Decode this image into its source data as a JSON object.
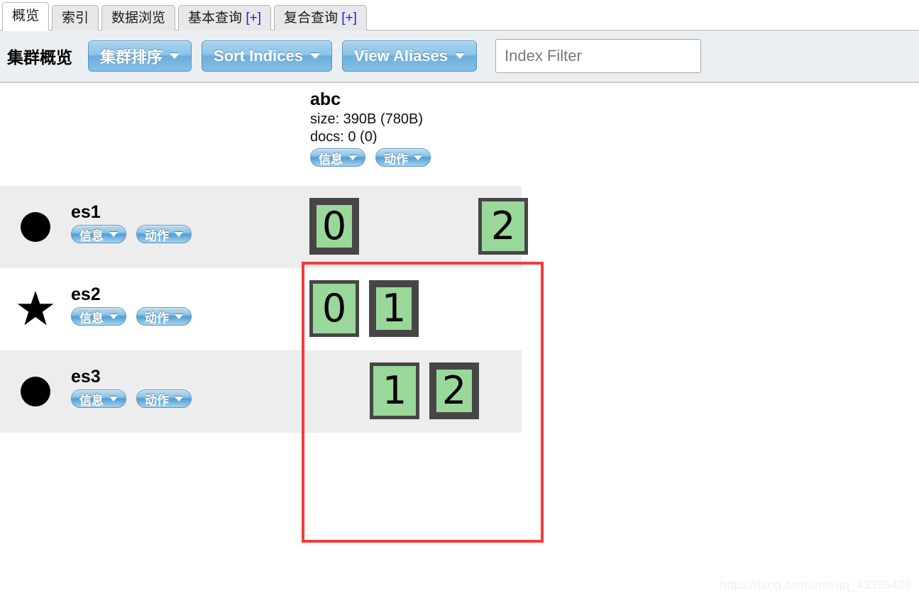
{
  "tabs": [
    {
      "label": "概览",
      "suffix": "",
      "active": true
    },
    {
      "label": "索引",
      "suffix": "",
      "active": false
    },
    {
      "label": "数据浏览",
      "suffix": "",
      "active": false
    },
    {
      "label": "基本查询",
      "suffix": "[+]",
      "active": false
    },
    {
      "label": "复合查询",
      "suffix": "[+]",
      "active": false
    }
  ],
  "toolbar": {
    "title": "集群概览",
    "sort_cluster_label": "集群排序",
    "sort_indices_label": "Sort Indices",
    "view_aliases_label": "View Aliases",
    "index_filter_placeholder": "Index Filter",
    "index_filter_value": "",
    "caret_icon": "chevron-down-icon"
  },
  "index_header": {
    "name": "abc",
    "size": "size: 390B (780B)",
    "docs": "docs: 0 (0)",
    "info_label": "信息",
    "action_label": "动作"
  },
  "nodes": [
    {
      "name": "es1",
      "icon": "circle-icon",
      "role": "data",
      "info_label": "信息",
      "action_label": "动作",
      "shards": [
        {
          "num": "0",
          "type": "primary"
        },
        {
          "num": "",
          "type": "empty"
        },
        {
          "num": "2",
          "type": "replica"
        }
      ]
    },
    {
      "name": "es2",
      "icon": "star-icon",
      "role": "master",
      "info_label": "信息",
      "action_label": "动作",
      "shards": [
        {
          "num": "0",
          "type": "replica"
        },
        {
          "num": "1",
          "type": "primary"
        },
        {
          "num": "",
          "type": "empty"
        }
      ]
    },
    {
      "name": "es3",
      "icon": "circle-icon",
      "role": "data",
      "info_label": "信息",
      "action_label": "动作",
      "shards": [
        {
          "num": "",
          "type": "empty"
        },
        {
          "num": "1",
          "type": "replica"
        },
        {
          "num": "2",
          "type": "primary"
        }
      ]
    }
  ],
  "annotation": {
    "color": "#f43c3c",
    "label": "shard-allocation-highlight"
  },
  "watermark": "https://blog.csdn.net/qq_43395428",
  "colors": {
    "shard_green": "#9ad89a",
    "shard_border": "#464646",
    "button_blue": "#6aaedd",
    "row_shaded": "#ededed",
    "toolbar_bg": "#eceff1"
  }
}
